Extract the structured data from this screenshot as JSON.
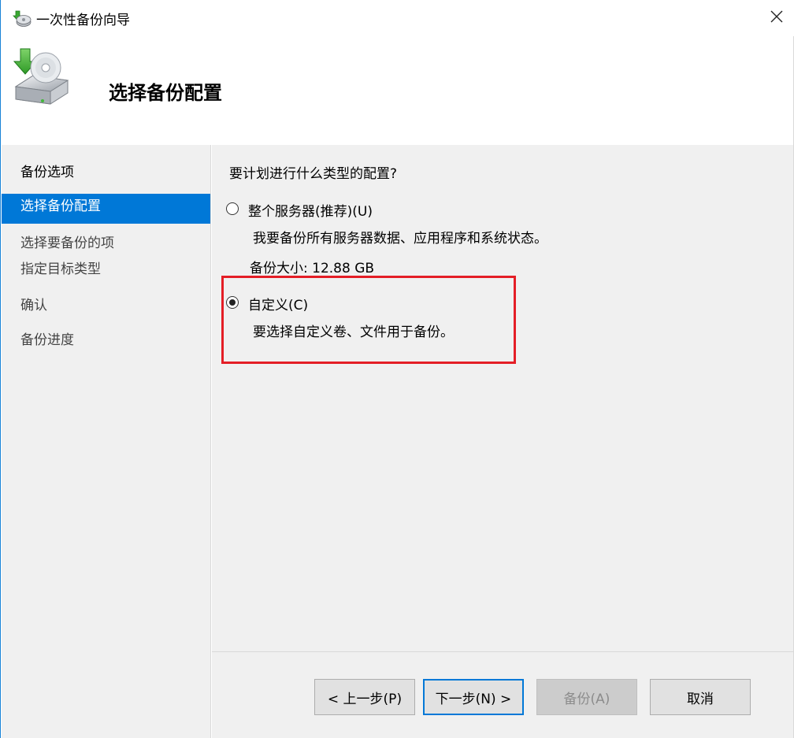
{
  "window": {
    "title": "一次性备份向导",
    "close_label": "关闭"
  },
  "header": {
    "title": "选择备份配置"
  },
  "nav": {
    "items": [
      {
        "label": "备份选项",
        "state": "normal"
      },
      {
        "label": "选择备份配置",
        "state": "active"
      },
      {
        "label": "选择要备份的项",
        "state": "dim"
      },
      {
        "label": "指定目标类型",
        "state": "dim"
      },
      {
        "label": "确认",
        "state": "dim"
      },
      {
        "label": "备份进度",
        "state": "dim"
      }
    ]
  },
  "main": {
    "question": "要计划进行什么类型的配置?",
    "options": [
      {
        "label": "整个服务器(推荐)(U)",
        "description": "我要备份所有服务器数据、应用程序和系统状态。",
        "size": "备份大小: 12.88 GB",
        "selected": false
      },
      {
        "label": "自定义(C)",
        "description": "要选择自定义卷、文件用于备份。",
        "selected": true
      }
    ]
  },
  "footer": {
    "back_label": "< 上一步(P)",
    "next_label": "下一步(N) >",
    "backup_label": "备份(A)",
    "cancel_label": "取消"
  },
  "colors": {
    "accent": "#0078d7",
    "highlight": "#e41e26",
    "panel": "#f0f0f0"
  },
  "icons": {
    "title": "backup-wizard-icon",
    "header": "backup-drive-icon",
    "close": "close-icon"
  }
}
